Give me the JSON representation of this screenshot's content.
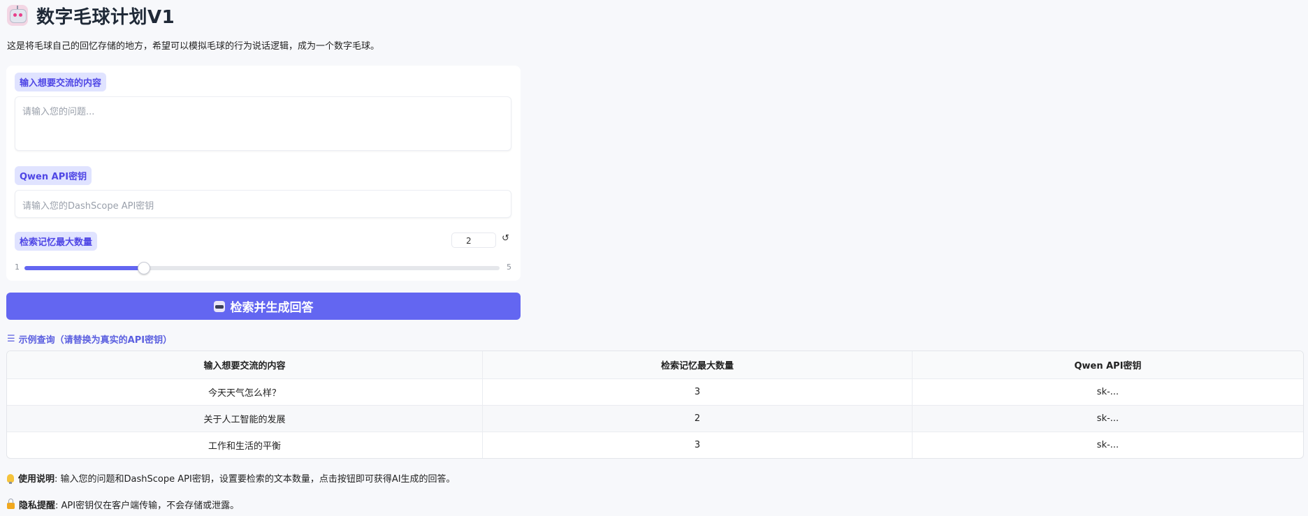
{
  "header": {
    "title": "数字毛球计划V1",
    "logo_icon": "robot-icon"
  },
  "subtitle": "这是将毛球自己的回忆存储的地方，希望可以模拟毛球的行为说话逻辑，成为一个数字毛球。",
  "form": {
    "question": {
      "label": "输入想要交流的内容",
      "placeholder": "请输入您的问题..."
    },
    "api_key": {
      "label": "Qwen API密钥",
      "placeholder": "请输入您的DashScope API密钥"
    },
    "max_count": {
      "label": "检索记忆最大数量",
      "value": "2",
      "min_label": "1",
      "max_label": "5",
      "min": 1,
      "max": 5,
      "current": 2,
      "reset_symbol": "↺"
    },
    "submit": {
      "label": "检索并生成回答",
      "icon": "robot-icon"
    }
  },
  "examples": {
    "title": "示例查询（请替换为真实的API密钥）",
    "icon": "list-icon",
    "headers": [
      "输入想要交流的内容",
      "检索记忆最大数量",
      "Qwen API密钥"
    ],
    "rows": [
      [
        "今天天气怎么样？",
        "3",
        "sk-..."
      ],
      [
        "关于人工智能的发展",
        "2",
        "sk-..."
      ],
      [
        "工作和生活的平衡",
        "3",
        "sk-..."
      ]
    ]
  },
  "notes": {
    "usage_title": "使用说明",
    "usage_text": ": 输入您的问题和DashScope API密钥，设置要检索的文本数量，点击按钮即可获得AI生成的回答。",
    "privacy_title": "隐私提醒",
    "privacy_text": ": API密钥仅在客户端传输，不会存储或泄露。"
  },
  "colors": {
    "accent": "#6366f1",
    "chip_bg": "#e0e3ff",
    "page_bg": "#f7f8fb"
  }
}
